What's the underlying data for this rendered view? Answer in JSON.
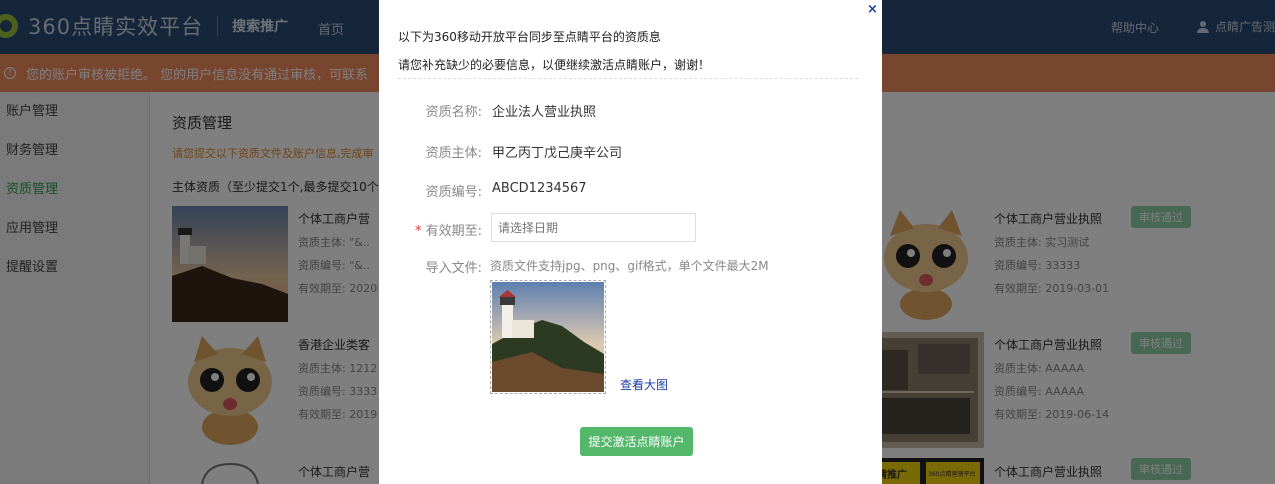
{
  "header": {
    "logo_text": "360点睛实效平台",
    "logo_sub": "搜索推广",
    "nav_home": "首页",
    "help": "帮助中心",
    "user": "点睛广告测"
  },
  "warning": {
    "text": "您的账户审核被拒绝。 您的用户信息没有通过审核，可联系"
  },
  "sidebar": {
    "items": [
      {
        "label": "账户管理"
      },
      {
        "label": "财务管理"
      },
      {
        "label": "资质管理"
      },
      {
        "label": "应用管理"
      },
      {
        "label": "提醒设置"
      }
    ]
  },
  "main": {
    "title": "资质管理",
    "tip": "请您提交以下资质文件及账户信息,完成审",
    "section": "主体资质（至少提交1个,最多提交10个",
    "labels": {
      "subject": "资质主体:",
      "number": "资质编号:",
      "valid": "有效期至:"
    },
    "cards_left": [
      {
        "title": "个体工商户营",
        "subject": "\"&..",
        "number": "\"&..",
        "valid": "2020"
      },
      {
        "title": "香港企业类客",
        "subject": "1212",
        "number": "3333",
        "valid": "2019"
      },
      {
        "title": "个体工商户营"
      }
    ],
    "cards_right": [
      {
        "title": "个体工商户营业执照",
        "subject": "实习测试",
        "number": "33333",
        "valid": "2019-03-01",
        "status": "审核通过"
      },
      {
        "title": "个体工商户营业执照",
        "subject": "AAAAA",
        "number": "AAAAA",
        "valid": "2019-06-14",
        "status": "审核通过"
      },
      {
        "title": "个体工商户营业执照",
        "status": "审核通过",
        "thumb_text_a": "睛推广",
        "thumb_text_b": "360点睛营销平台"
      }
    ]
  },
  "modal": {
    "close": "×",
    "line1": "以下为360移动开放平台同步至点睛平台的资质息",
    "line2": "请您补充缺少的必要信息，以便继续激活点睛账户，谢谢！",
    "fields": {
      "name_label": "资质名称:",
      "name_value": "企业法人营业执照",
      "subject_label": "资质主体:",
      "subject_value": "甲乙丙丁戊己庚辛公司",
      "number_label": "资质编号:",
      "number_value": "ABCD1234567",
      "valid_label": "有效期至:",
      "valid_star": "*",
      "valid_placeholder": "请选择日期",
      "upload_label": "导入文件:",
      "upload_hint": "资质文件支持jpg、png、gif格式，单个文件最大2M"
    },
    "view_big": "查看大图",
    "submit": "提交激活点睛账户"
  }
}
